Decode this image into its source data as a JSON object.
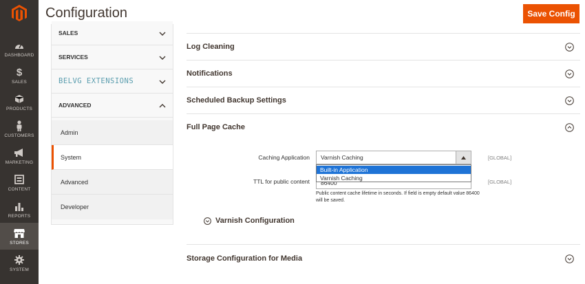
{
  "nav": {
    "items": [
      {
        "label": "DASHBOARD",
        "icon": "dashboard-icon"
      },
      {
        "label": "SALES",
        "icon": "dollar-icon"
      },
      {
        "label": "PRODUCTS",
        "icon": "cube-icon"
      },
      {
        "label": "CUSTOMERS",
        "icon": "person-icon"
      },
      {
        "label": "MARKETING",
        "icon": "megaphone-icon"
      },
      {
        "label": "CONTENT",
        "icon": "layout-icon"
      },
      {
        "label": "REPORTS",
        "icon": "bar-chart-icon"
      },
      {
        "label": "STORES",
        "icon": "store-icon"
      },
      {
        "label": "SYSTEM",
        "icon": "gear-icon"
      }
    ],
    "active": "STORES",
    "logo": "magento-logo",
    "bg_color": "#373330",
    "accent_color": "#eb5202"
  },
  "header": {
    "title": "Configuration",
    "save_label": "Save Config"
  },
  "tabs": {
    "groups": [
      {
        "label": "SALES",
        "expanded": false
      },
      {
        "label": "SERVICES",
        "expanded": false
      },
      {
        "label": "BELVG EXTENSIONS",
        "expanded": false
      },
      {
        "label": "ADVANCED",
        "expanded": true
      }
    ],
    "advanced_items": [
      {
        "label": "Admin"
      },
      {
        "label": "System"
      },
      {
        "label": "Advanced"
      },
      {
        "label": "Developer"
      }
    ],
    "active_item": "System"
  },
  "sections": {
    "log_cleaning": "Log Cleaning",
    "notifications": "Notifications",
    "scheduled_backup": "Scheduled Backup Settings",
    "full_page_cache": "Full Page Cache",
    "storage_media": "Storage Configuration for Media"
  },
  "full_page_cache": {
    "caching_application": {
      "label": "Caching Application",
      "value": "Varnish Caching",
      "scope": "[GLOBAL]",
      "options": [
        "Built-in Application",
        "Varnish Caching"
      ],
      "highlighted_option": "Built-in Application"
    },
    "ttl": {
      "label": "TTL for public content",
      "value": "86400",
      "scope": "[GLOBAL]",
      "hint": "Public content cache lifetime in seconds. If field is empty default value 86400 will be saved."
    },
    "varnish_configuration": "Varnish Configuration"
  }
}
